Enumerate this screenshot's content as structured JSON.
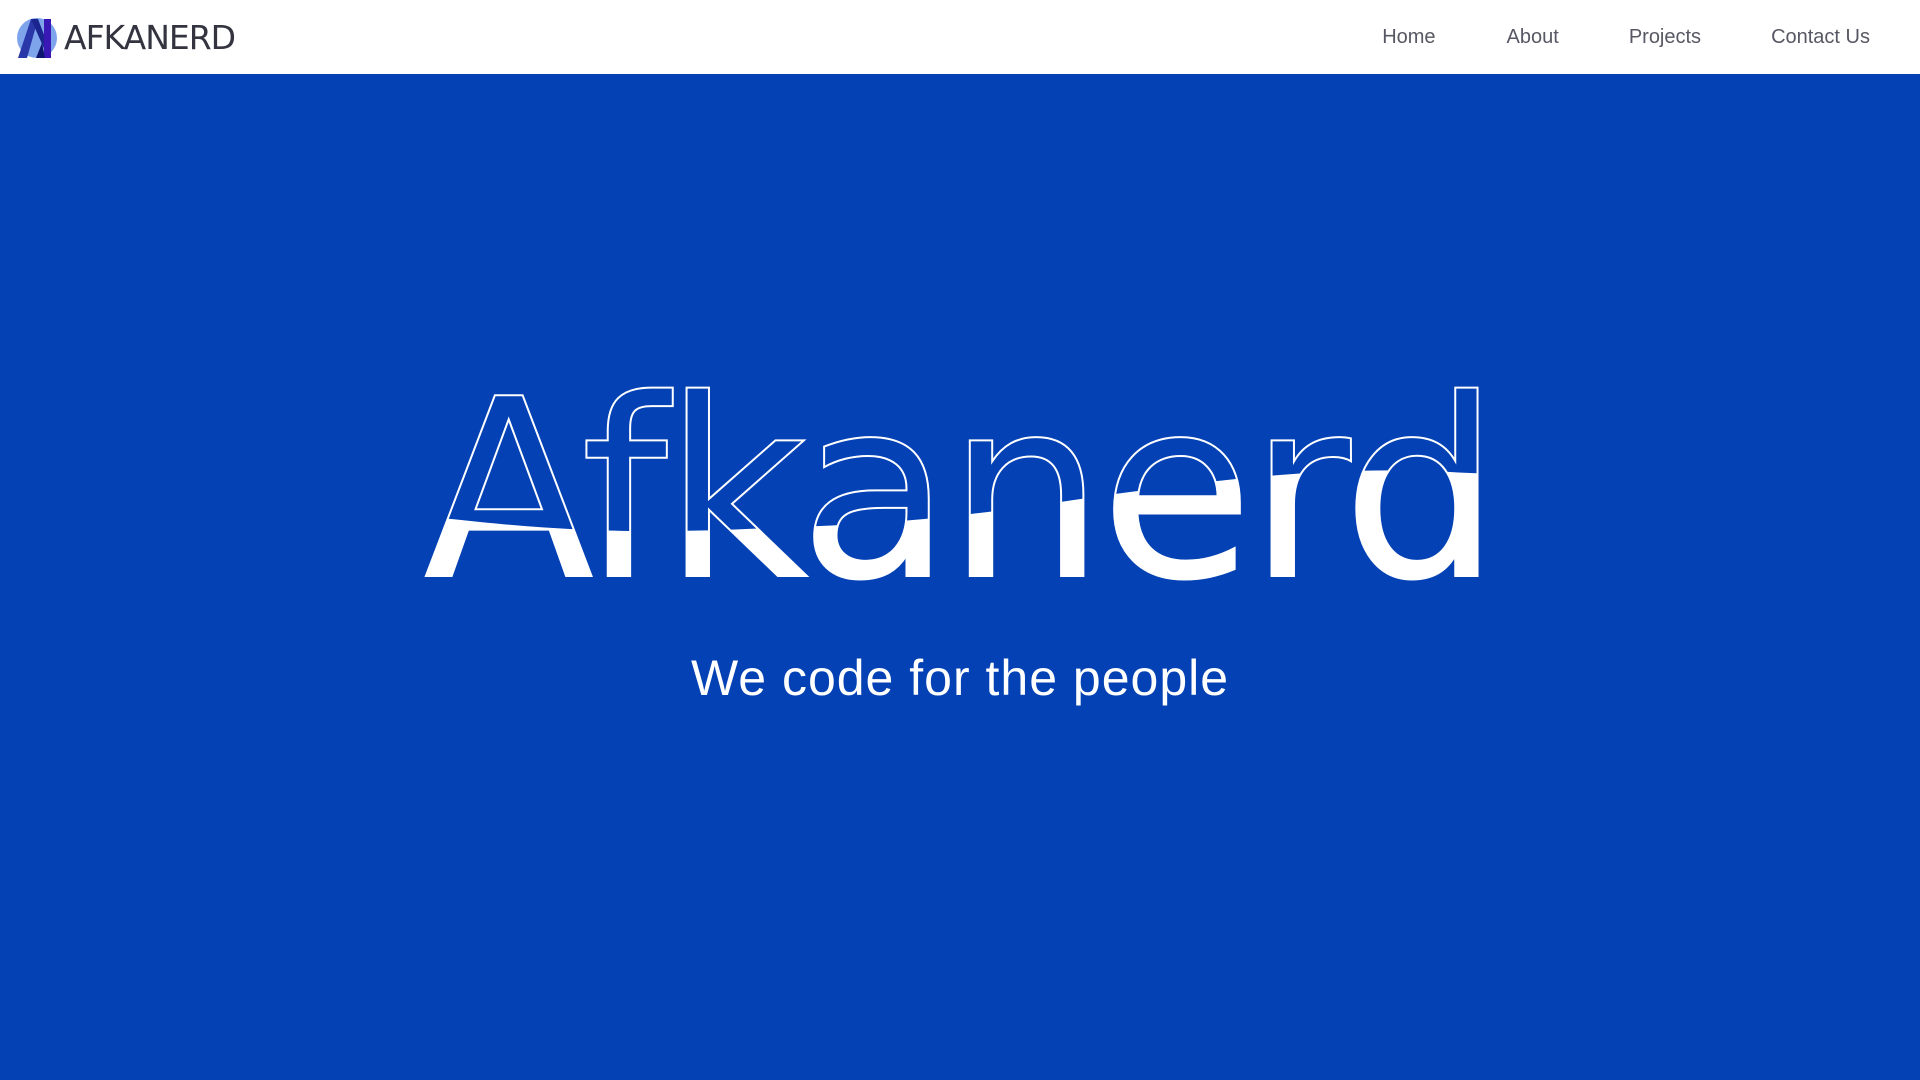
{
  "header": {
    "brand": "AFKANERD",
    "logo_icon": "afkanerd-n-logo-icon",
    "nav": [
      {
        "label": "Home"
      },
      {
        "label": "About"
      },
      {
        "label": "Projects"
      },
      {
        "label": "Contact Us"
      }
    ]
  },
  "hero": {
    "title": "Afkanerd",
    "tagline": "We code for the people",
    "background": "#0341b4",
    "text_color": "#ffffff"
  }
}
